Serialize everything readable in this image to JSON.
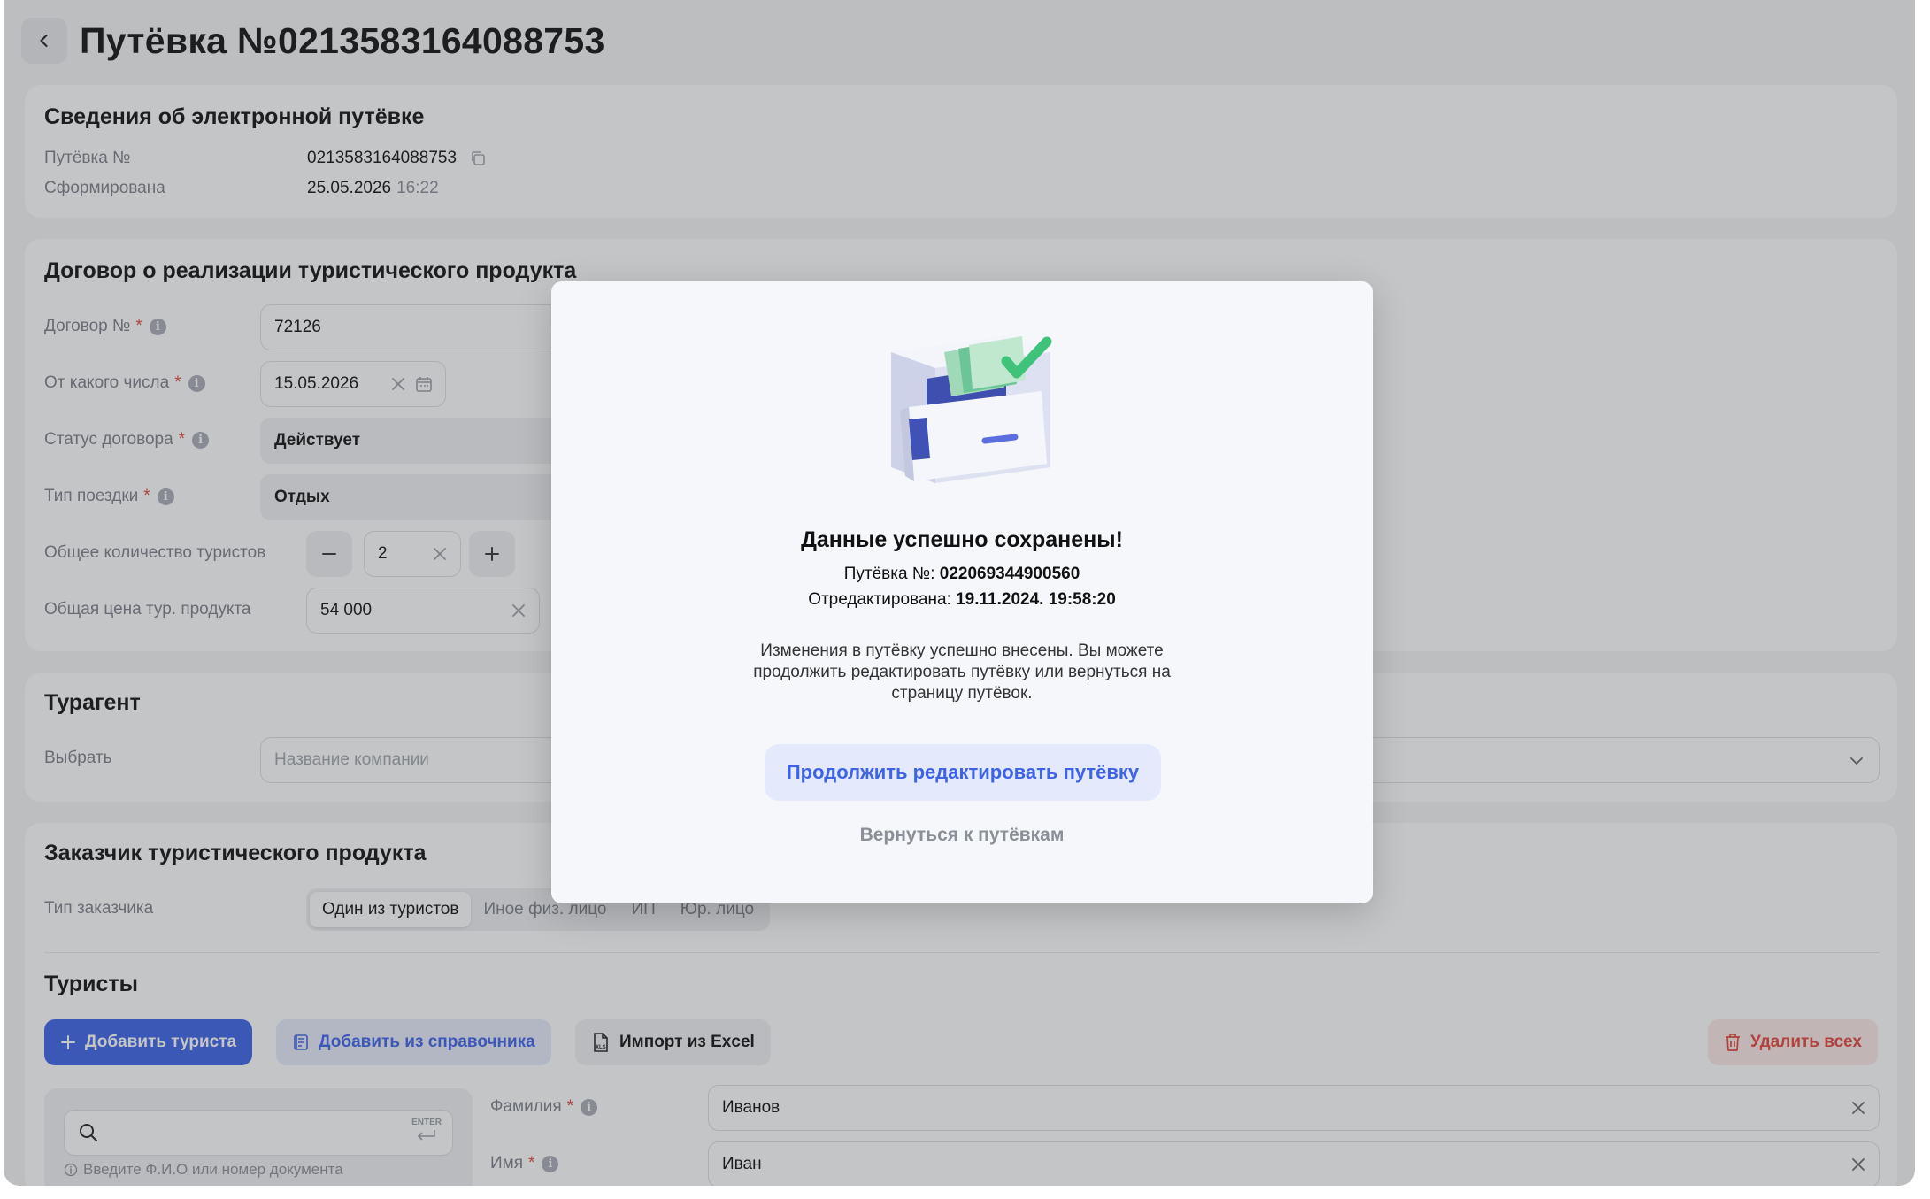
{
  "header": {
    "title": "Путёвка №0213583164088753"
  },
  "voucher_info": {
    "title": "Сведения об электронной путёвке",
    "number_label": "Путёвка №",
    "number_value": "0213583164088753",
    "created_label": "Сформирована",
    "created_date": "25.05.2026",
    "created_time": "16:22"
  },
  "contract": {
    "title": "Договор о реализации туристического продукта",
    "number_label": "Договор №",
    "number_value": "72126",
    "date_label": "От какого числа",
    "date_value": "15.05.2026",
    "status_label": "Статус договора",
    "status_value": "Действует",
    "trip_type_label": "Тип поездки",
    "trip_type_value": "Отдых",
    "tourists_count_label": "Общее количество туристов",
    "tourists_count_value": "2",
    "price_label": "Общая цена тур. продукта",
    "price_value": "54 000",
    "required_mark": "*",
    "info_glyph": "i"
  },
  "agent": {
    "title": "Турагент",
    "select_label": "Выбрать",
    "select_placeholder": "Название компании"
  },
  "customer": {
    "title": "Заказчик туристического продукта",
    "type_label": "Тип заказчика",
    "type_options": [
      "Один из туристов",
      "Иное физ. лицо",
      "ИП",
      "Юр. лицо"
    ],
    "selected": "Один из туристов"
  },
  "tourists": {
    "title": "Туристы",
    "add_button": "Добавить туриста",
    "add_from_directory_button": "Добавить из справочника",
    "import_excel_button": "Импорт из Excel",
    "delete_all_button": "Удалить всех",
    "search_enter_hint": "ENTER",
    "search_hint": "Введите Ф.И.О или номер документа",
    "last_name_label": "Фамилия",
    "last_name_value": "Иванов",
    "first_name_label": "Имя",
    "first_name_value": "Иван"
  },
  "modal": {
    "title": "Данные успешно сохранены!",
    "voucher_label": "Путёвка №:",
    "voucher_value": "022069344900560",
    "edited_label": "Отредактирована:",
    "edited_value": "19.11.2024. 19:58:20",
    "description": "Изменения в путёвку успешно внесены. Вы можете продолжить редактировать путёвку или вернуться на страницу путёвок.",
    "continue_button": "Продолжить редактировать путёвку",
    "back_button": "Вернуться к путёвкам"
  },
  "icons": {
    "back": "chevron-left-icon",
    "copy": "copy-icon",
    "clear": "close-icon",
    "calendar": "calendar-icon",
    "minus": "minus-icon",
    "plus": "plus-icon",
    "dropdown": "chevron-down-icon",
    "directory": "book-icon",
    "excel": "xls-file-icon",
    "trash": "trash-icon",
    "search": "search-icon",
    "enter": "enter-key-icon",
    "hint": "info-icon",
    "illustration": "file-cabinet-check-icon"
  },
  "colors": {
    "accent": "#3d63e8",
    "danger": "#e2453c",
    "success": "#3fc27a"
  }
}
